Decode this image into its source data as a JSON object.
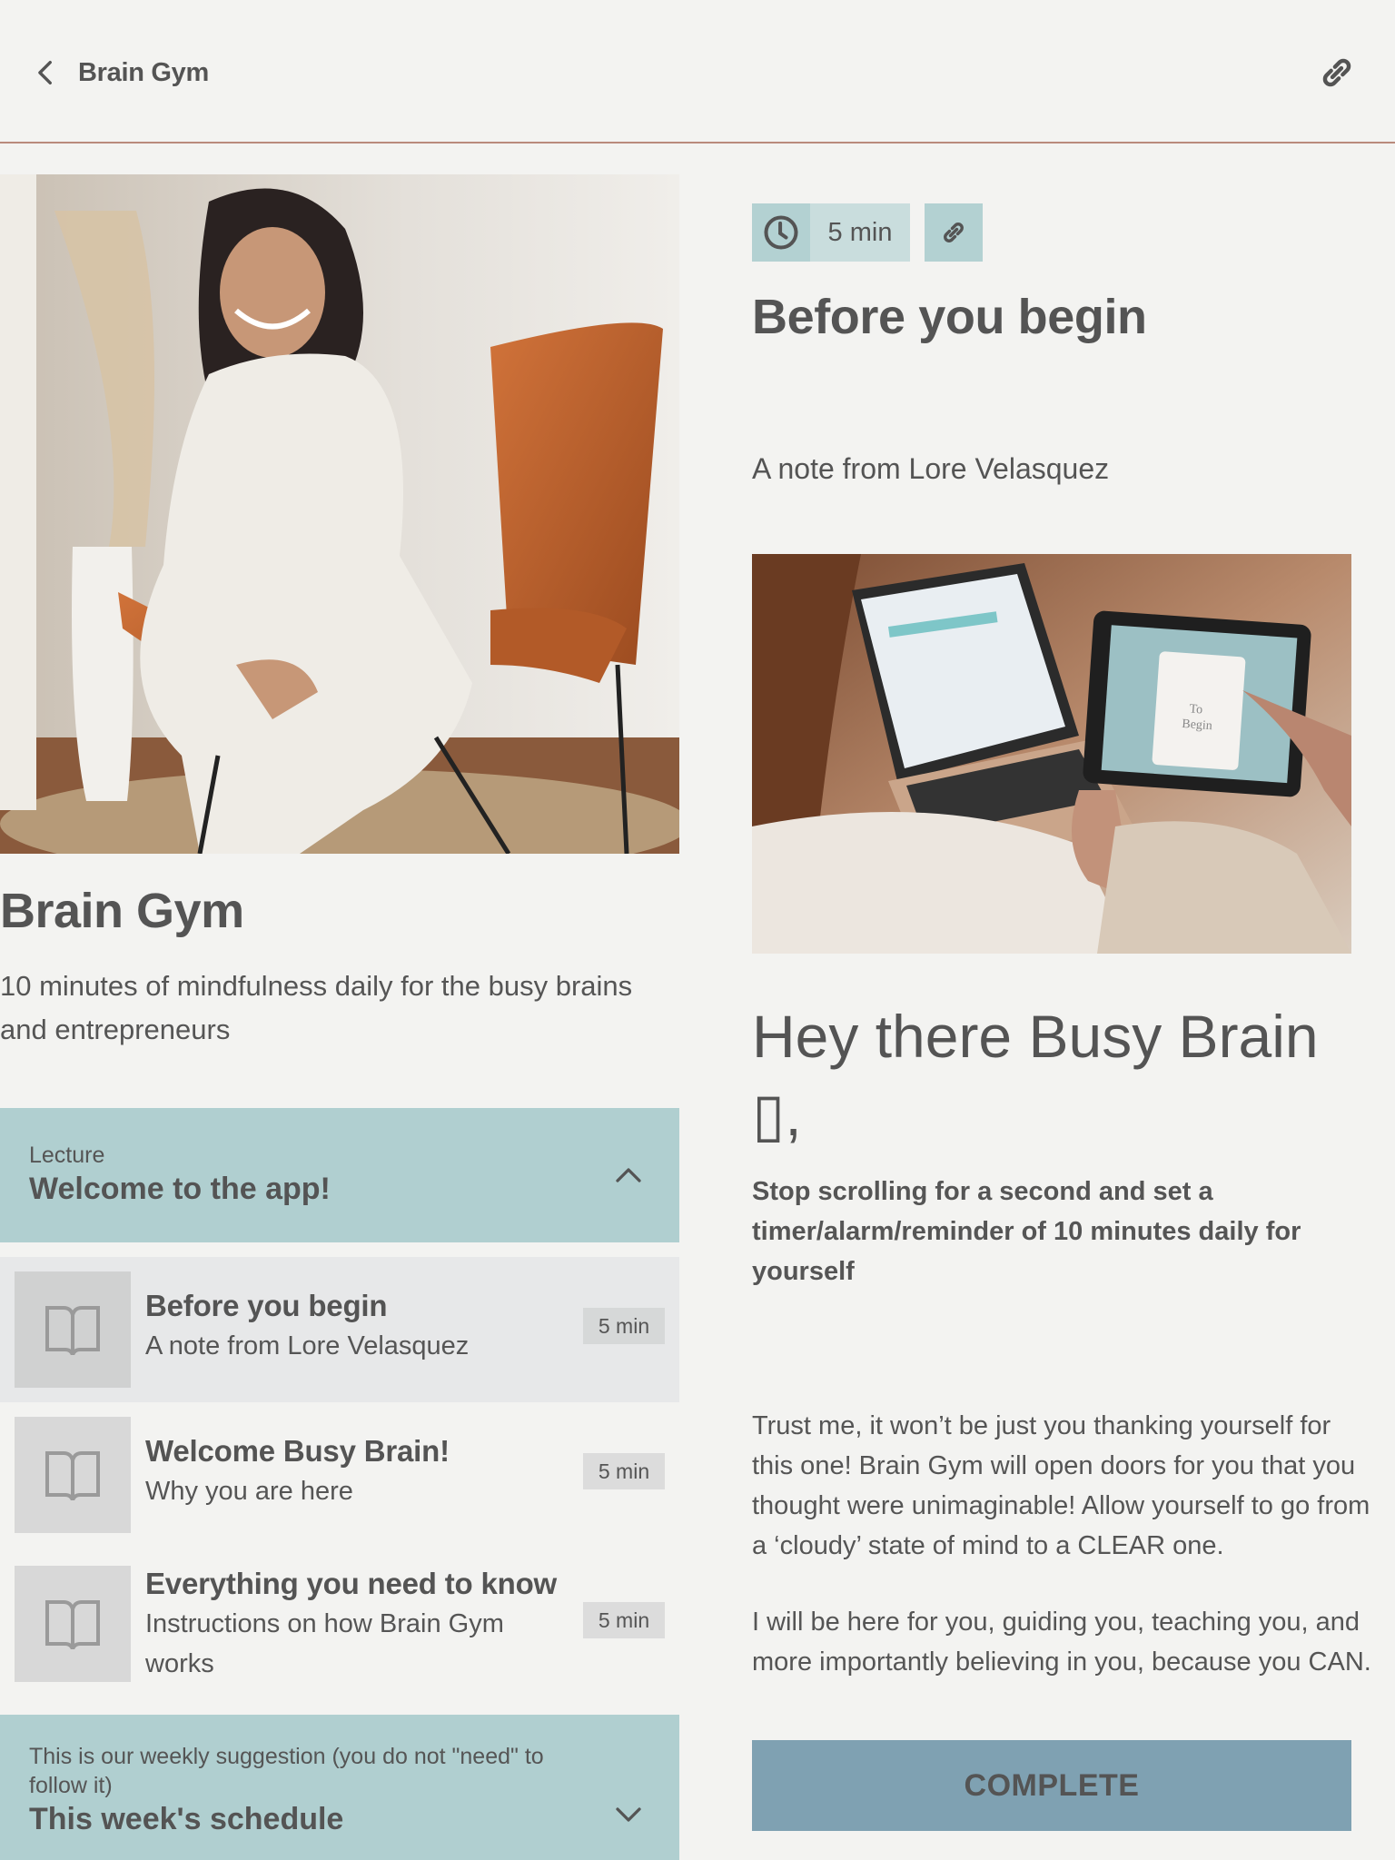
{
  "topbar": {
    "back_icon": "chevron-left-icon",
    "title": "Brain Gym",
    "share_icon": "link-icon"
  },
  "course": {
    "title": "Brain Gym",
    "description": "10 minutes of mindfulness daily for the busy brains and entrepreneurs",
    "hero_image_alt": "Woman in white outfit smiling, seated in a leather butterfly chair next to a vase of pampas grass"
  },
  "sections": [
    {
      "kicker": "Lecture",
      "title": "Welcome to the app!",
      "expanded": true,
      "chevron_icon": "chevron-up-icon",
      "lessons": [
        {
          "icon": "book-icon",
          "title": "Before you begin",
          "subtitle": "A note from Lore Velasquez",
          "duration": "5 min",
          "active": true
        },
        {
          "icon": "book-icon",
          "title": "Welcome Busy Brain!",
          "subtitle": "Why you are here",
          "duration": "5 min",
          "active": false
        },
        {
          "icon": "book-icon",
          "title": "Everything you need to know",
          "subtitle": "Instructions on how Brain Gym works",
          "duration": "5 min",
          "active": false
        }
      ]
    },
    {
      "kicker": "This is our weekly suggestion (you do not \"need\" to follow it)",
      "title": "This week's schedule",
      "expanded": false,
      "chevron_icon": "chevron-down-icon"
    }
  ],
  "lesson_detail": {
    "duration": "5 min",
    "clock_icon": "clock-icon",
    "link_icon": "link-icon",
    "title": "Before you begin",
    "byline": "A note from Lore Velasquez",
    "image_alt": "Hands holding a tablet showing a 'To Begin' card, laptop with calendar in background",
    "greeting": "Hey there Busy Brain ▯,",
    "callout": "Stop scrolling for a second and set a timer/alarm/reminder of 10 minutes daily for yourself",
    "paragraphs": [
      "Trust me, it won’t be just you thanking yourself for this one! Brain Gym will open doors for you that you thought were unimaginable! Allow yourself to go from a ‘cloudy’ state of mind to a CLEAR one.",
      "I will be here for you, guiding you, teaching you, and more importantly believing in you, because you CAN."
    ],
    "complete_label": "COMPLETE"
  },
  "colors": {
    "background": "#f3f3f1",
    "text": "#545454",
    "divider": "#b98a7c",
    "section_header": "#b0cfd0",
    "chip": "#b3d1d2",
    "chip_light": "#c9dddd",
    "active_row": "#e7e8e9",
    "complete_button": "#7fa1b2"
  }
}
